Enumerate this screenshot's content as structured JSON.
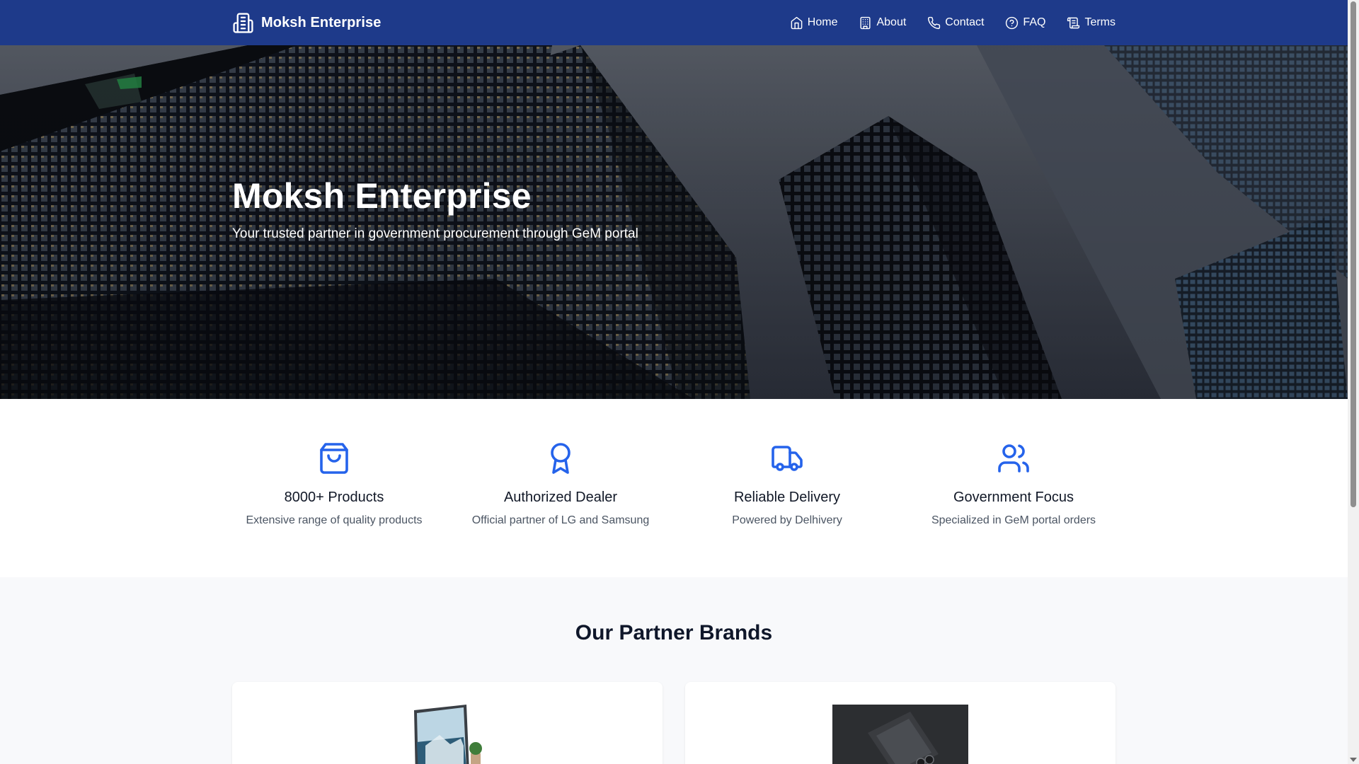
{
  "nav": {
    "brand": "Moksh Enterprise",
    "links": [
      {
        "label": "Home",
        "icon": "home-icon"
      },
      {
        "label": "About",
        "icon": "building-icon"
      },
      {
        "label": "Contact",
        "icon": "phone-icon"
      },
      {
        "label": "FAQ",
        "icon": "help-circle-icon"
      },
      {
        "label": "Terms",
        "icon": "scroll-icon"
      }
    ]
  },
  "hero": {
    "title": "Moksh Enterprise",
    "subtitle": "Your trusted partner in government procurement through GeM portal"
  },
  "features": [
    {
      "icon": "shopping-bag-icon",
      "title": "8000+ Products",
      "desc": "Extensive range of quality products"
    },
    {
      "icon": "award-icon",
      "title": "Authorized Dealer",
      "desc": "Official partner of LG and Samsung"
    },
    {
      "icon": "truck-icon",
      "title": "Reliable Delivery",
      "desc": "Powered by Delhivery"
    },
    {
      "icon": "users-icon",
      "title": "Government Focus",
      "desc": "Specialized in GeM portal orders"
    }
  ],
  "brands": {
    "heading": "Our Partner Brands"
  },
  "colors": {
    "navbar": "#1e3a8a",
    "accent": "#2563eb",
    "brands_bg": "#f8f9fb"
  }
}
